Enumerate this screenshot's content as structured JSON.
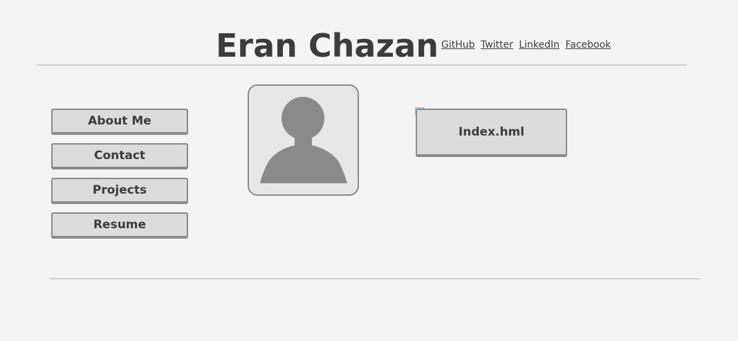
{
  "header": {
    "title": "Eran Chazan",
    "links": [
      {
        "label": "GitHub"
      },
      {
        "label": "Twitter"
      },
      {
        "label": "LinkedIn"
      },
      {
        "label": "Facebook"
      }
    ]
  },
  "nav": {
    "items": [
      {
        "label": "About Me"
      },
      {
        "label": "Contact"
      },
      {
        "label": "Projects"
      },
      {
        "label": "Resume"
      }
    ]
  },
  "main": {
    "avatar_icon": "user-silhouette-icon",
    "broken_image_icon": "broken-image-icon",
    "index_button_label": "Index.hml"
  },
  "colors": {
    "background": "#f4f4f4",
    "button_fill": "#dcdcdc",
    "button_border": "#8a8a8a",
    "text": "#3c3c3c",
    "avatar_silhouette": "#8a8a8a",
    "rule": "#cfcfcf"
  }
}
